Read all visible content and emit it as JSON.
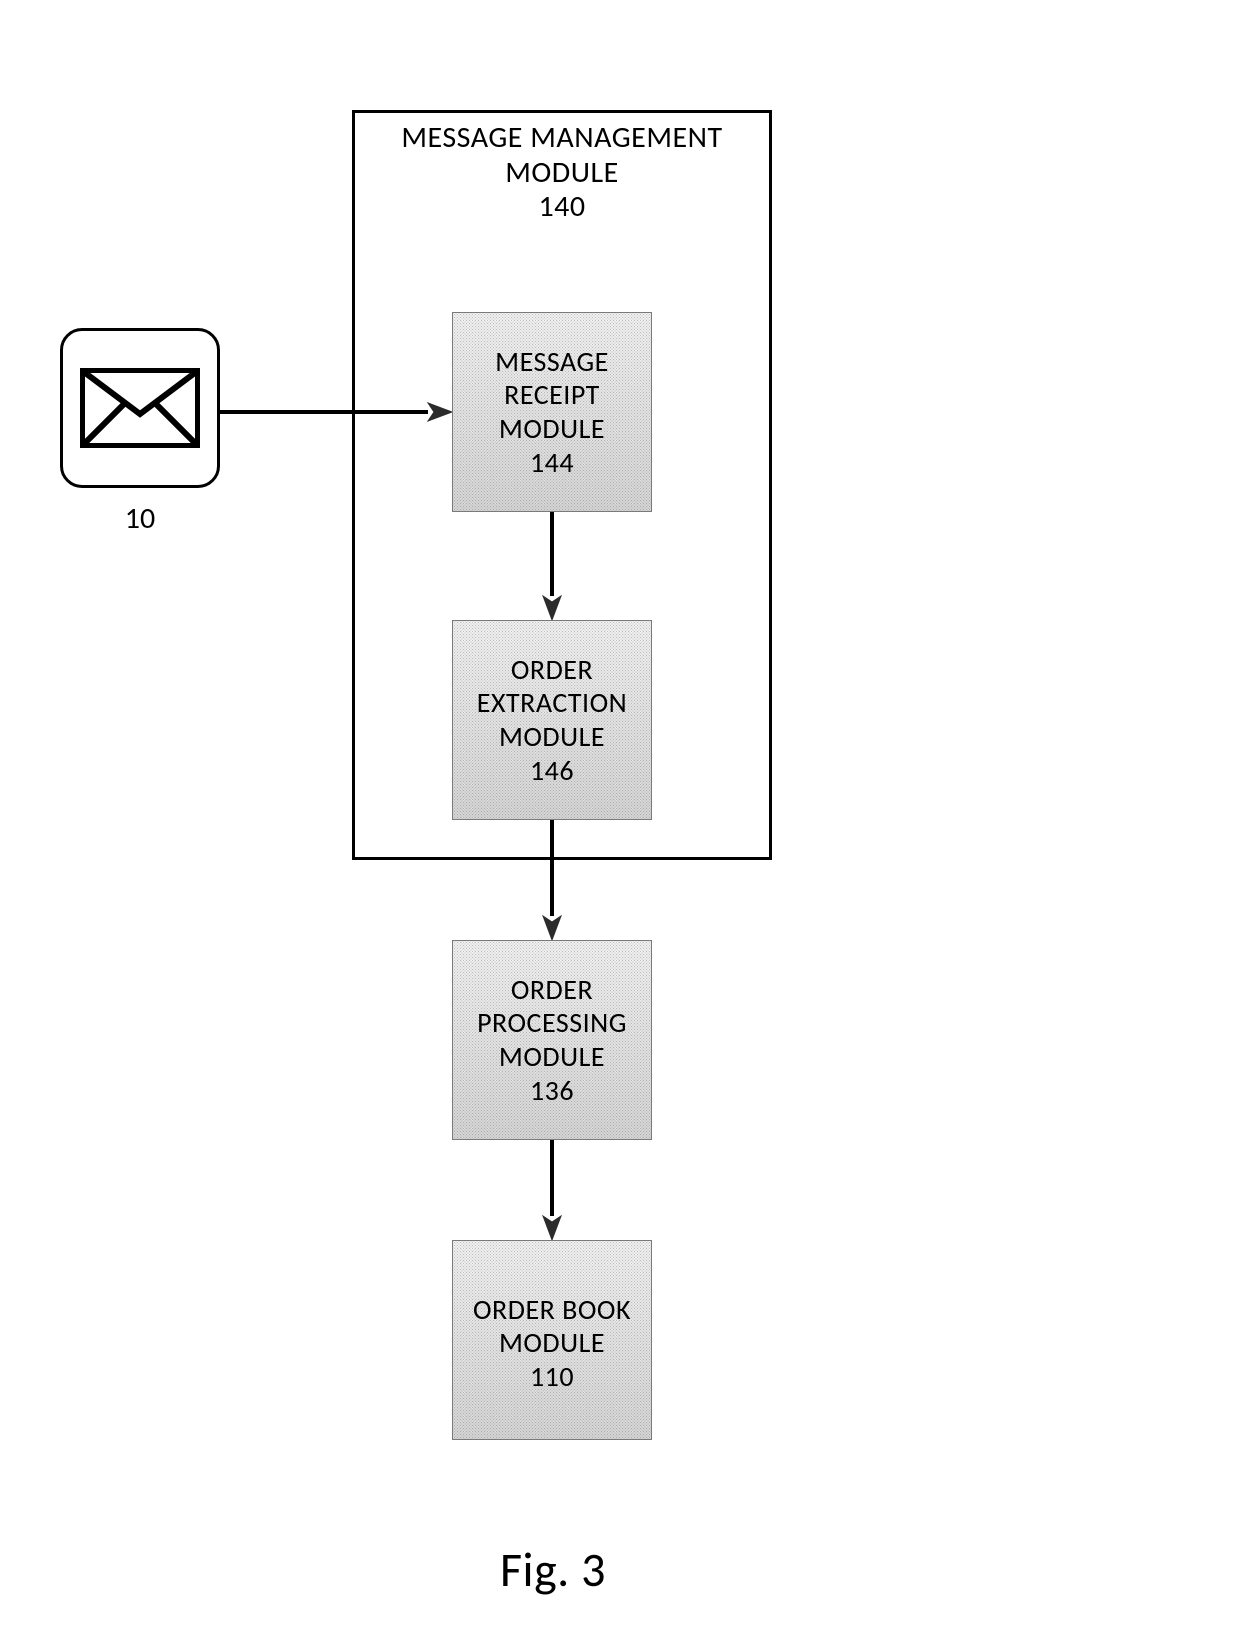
{
  "container": {
    "title_line1": "MESSAGE MANAGEMENT",
    "title_line2": "MODULE",
    "ref": "140"
  },
  "envelope": {
    "ref": "10"
  },
  "modules": {
    "message_receipt": {
      "line1": "MESSAGE",
      "line2": "RECEIPT",
      "line3": "MODULE",
      "ref": "144"
    },
    "order_extraction": {
      "line1": "ORDER",
      "line2": "EXTRACTION",
      "line3": "MODULE",
      "ref": "146"
    },
    "order_processing": {
      "line1": "ORDER",
      "line2": "PROCESSING",
      "line3": "MODULE",
      "ref": "136"
    },
    "order_book": {
      "line1": "ORDER BOOK",
      "line2": "MODULE",
      "ref": "110"
    }
  },
  "figure_caption": "Fig. 3"
}
